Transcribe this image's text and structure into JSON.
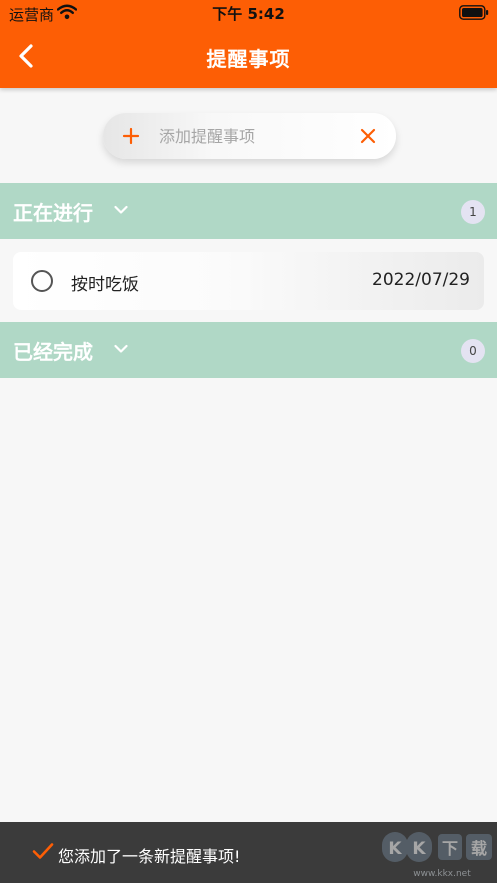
{
  "status_bar": {
    "carrier": "运营商",
    "time": "下午 5:42"
  },
  "nav": {
    "title": "提醒事项"
  },
  "add_bar": {
    "placeholder": "添加提醒事项",
    "value": ""
  },
  "sections": {
    "in_progress": {
      "title": "正在进行",
      "count": "1"
    },
    "completed": {
      "title": "已经完成",
      "count": "0"
    }
  },
  "tasks": [
    {
      "title": "按时吃饭",
      "date": "2022/07/29"
    }
  ],
  "toast": {
    "message": "您添加了一条新提醒事项!"
  },
  "watermark": {
    "text": "KK下载",
    "url_text": "www.kkx.net"
  },
  "colors": {
    "brand_orange": "#fd5e05",
    "section_green": "#b0d8c6",
    "toast_bg": "#3b3b3b"
  },
  "icons": {
    "back": "chevron-left-icon",
    "add": "plus-icon",
    "clear": "close-icon",
    "section_toggle": "chevron-down-icon",
    "task_status": "circle-icon",
    "toast_status": "check-icon"
  }
}
